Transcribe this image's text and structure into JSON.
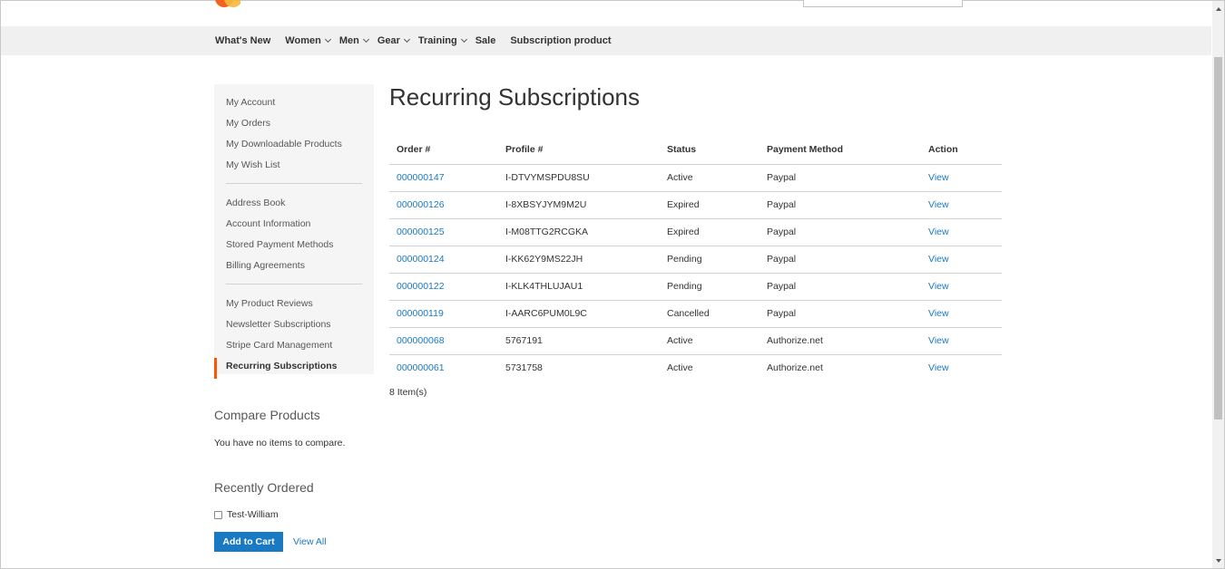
{
  "colors": {
    "accent": "#1979c3",
    "active_marker": "#ff5501",
    "nav_bg": "#f0f0f0",
    "sidebar_bg": "#f5f5f5"
  },
  "nav": {
    "items": [
      {
        "label": "What's New",
        "dropdown": false
      },
      {
        "label": "Women",
        "dropdown": true
      },
      {
        "label": "Men",
        "dropdown": true
      },
      {
        "label": "Gear",
        "dropdown": true
      },
      {
        "label": "Training",
        "dropdown": true
      },
      {
        "label": "Sale",
        "dropdown": false
      },
      {
        "label": "Subscription product",
        "dropdown": false
      }
    ]
  },
  "account_nav": {
    "group1": [
      "My Account",
      "My Orders",
      "My Downloadable Products",
      "My Wish List"
    ],
    "group2": [
      "Address Book",
      "Account Information",
      "Stored Payment Methods",
      "Billing Agreements"
    ],
    "group3": [
      "My Product Reviews",
      "Newsletter Subscriptions",
      "Stripe Card Management",
      "Recurring Subscriptions"
    ],
    "current": "Recurring Subscriptions"
  },
  "compare": {
    "title": "Compare Products",
    "empty_text": "You have no items to compare."
  },
  "recently_ordered": {
    "title": "Recently Ordered",
    "item": "Test-William",
    "add_to_cart": "Add to Cart",
    "view_all": "View All"
  },
  "main": {
    "title": "Recurring Subscriptions",
    "columns": {
      "order": "Order #",
      "profile": "Profile #",
      "status": "Status",
      "payment": "Payment Method",
      "action": "Action"
    },
    "rows": [
      {
        "order": "000000147",
        "profile": "I-DTVYMSPDU8SU",
        "status": "Active",
        "payment": "Paypal",
        "action": "View"
      },
      {
        "order": "000000126",
        "profile": "I-8XBSYJYM9M2U",
        "status": "Expired",
        "payment": "Paypal",
        "action": "View"
      },
      {
        "order": "000000125",
        "profile": "I-M08TTG2RCGKA",
        "status": "Expired",
        "payment": "Paypal",
        "action": "View"
      },
      {
        "order": "000000124",
        "profile": "I-KK62Y9MS22JH",
        "status": "Pending",
        "payment": "Paypal",
        "action": "View"
      },
      {
        "order": "000000122",
        "profile": "I-KLK4THLUJAU1",
        "status": "Pending",
        "payment": "Paypal",
        "action": "View"
      },
      {
        "order": "000000119",
        "profile": "I-AARC6PUM0L9C",
        "status": "Cancelled",
        "payment": "Paypal",
        "action": "View"
      },
      {
        "order": "000000068",
        "profile": "5767191",
        "status": "Active",
        "payment": "Authorize.net",
        "action": "View"
      },
      {
        "order": "000000061",
        "profile": "5731758",
        "status": "Active",
        "payment": "Authorize.net",
        "action": "View"
      }
    ],
    "items_count": "8 Item(s)"
  },
  "icons": {
    "nav_dropdown": "chevron-down-icon",
    "scroll_up": "arrow-up-icon",
    "scroll_down": "arrow-down-icon",
    "checkbox": "checkbox-icon"
  }
}
